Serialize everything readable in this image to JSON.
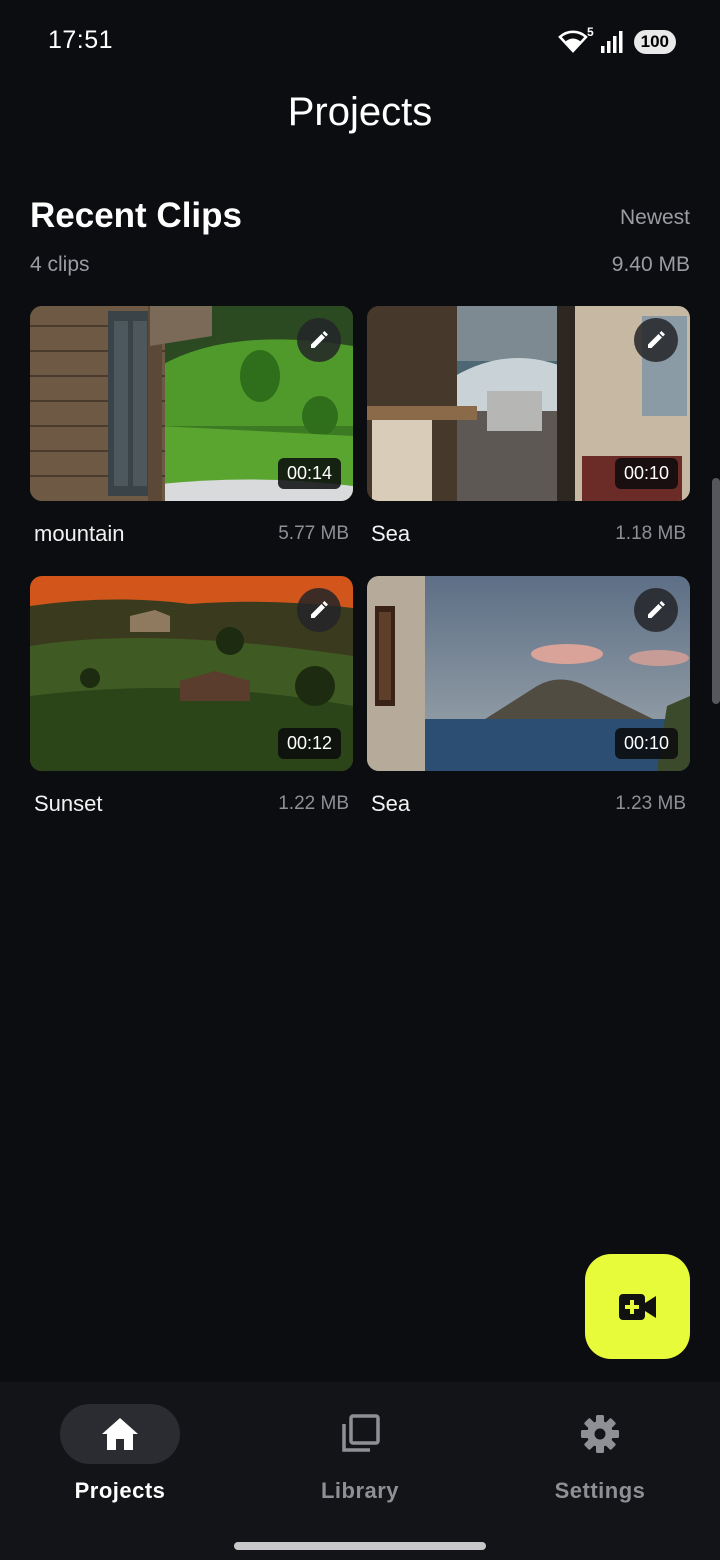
{
  "status_bar": {
    "time": "17:51",
    "wifi_label": "5",
    "battery": "100"
  },
  "header": {
    "title": "Projects"
  },
  "section": {
    "title": "Recent Clips",
    "sort_label": "Newest",
    "clip_count": "4 clips",
    "total_size": "9.40 MB"
  },
  "clips": [
    {
      "name": "mountain",
      "size": "5.77 MB",
      "duration": "00:14"
    },
    {
      "name": "Sea",
      "size": "1.18 MB",
      "duration": "00:10"
    },
    {
      "name": "Sunset",
      "size": "1.22 MB",
      "duration": "00:12"
    },
    {
      "name": "Sea",
      "size": "1.23 MB",
      "duration": "00:10"
    }
  ],
  "fab": {
    "icon": "add-video-icon"
  },
  "bottom_nav": {
    "items": [
      {
        "label": "Projects",
        "icon": "home-icon",
        "active": true
      },
      {
        "label": "Library",
        "icon": "library-icon",
        "active": false
      },
      {
        "label": "Settings",
        "icon": "gear-icon",
        "active": false
      }
    ]
  },
  "colors": {
    "background": "#0c0d10",
    "accent": "#e7fb3b",
    "nav_background": "#131417"
  }
}
